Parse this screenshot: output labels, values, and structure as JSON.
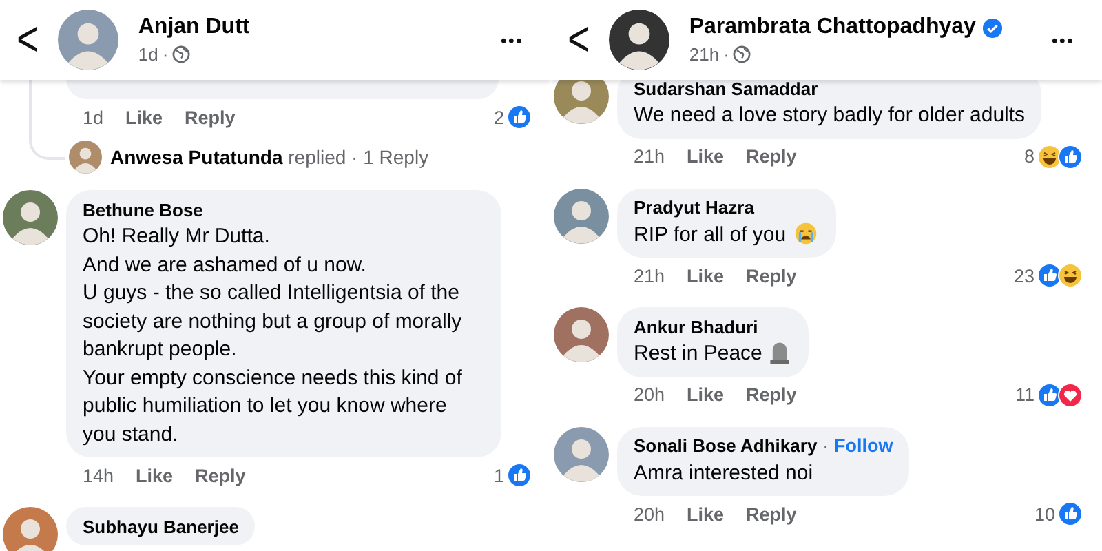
{
  "panels": [
    {
      "header": {
        "back": "<",
        "name": "Anjan Dutt",
        "verified": false,
        "time": "1d",
        "separator": "·",
        "more": "•••"
      },
      "comments": [
        {
          "kind": "hidden",
          "time": "1d",
          "like": "Like",
          "reply": "Reply",
          "count": "2",
          "reactions": [
            {
              "kind": "like"
            }
          ],
          "replies": "**Anwesa Putatunda** replied · 1 Reply"
        },
        {
          "kind": "comment",
          "name": "Bethune Bose",
          "text": "Oh! Really Mr Dutta.\nAnd we are ashamed of u now.\nU guys - the so called Intelligentsia of the society are nothing but a group of morally bankrupt people.\nYour empty conscience needs this kind of public humiliation to let you know where you stand.",
          "time": "14h",
          "like": "Like",
          "reply": "Reply",
          "count": "1",
          "reactions": [
            {
              "kind": "like"
            }
          ]
        },
        {
          "kind": "comment",
          "name": "Subhayu Banerjee"
        }
      ]
    },
    {
      "header": {
        "back": "<",
        "name": "Parambrata Chattopadhyay",
        "verified": true,
        "time": "21h",
        "separator": "·",
        "more": "•••"
      },
      "comments": [
        {
          "kind": "comment",
          "name": "Sudarshan Samaddar",
          "text": "We need a love story badly for older adults",
          "time": "21h",
          "like": "Like",
          "reply": "Reply",
          "count": "8",
          "reactions": [
            {
              "kind": "haha"
            },
            {
              "kind": "like"
            }
          ]
        },
        {
          "kind": "comment",
          "name": "Pradyut Hazra",
          "text": "RIP for all of you",
          "trailing_icon": {
            "kind": "crying"
          },
          "time": "21h",
          "like": "Like",
          "reply": "Reply",
          "count": "23",
          "reactions": [
            {
              "kind": "like"
            },
            {
              "kind": "haha"
            }
          ]
        },
        {
          "kind": "comment",
          "name": "Ankur Bhaduri",
          "text": "Rest in Peace",
          "trailing_icon": {
            "kind": "tombstone"
          },
          "time": "20h",
          "like": "Like",
          "reply": "Reply",
          "count": "11",
          "reactions": [
            {
              "kind": "like"
            },
            {
              "kind": "love"
            }
          ]
        },
        {
          "kind": "comment",
          "name": "Sonali Bose Adhikary",
          "follow_separator": "·",
          "follow": "Follow",
          "text": "Amra interested noi",
          "time": "20h",
          "like": "Like",
          "reply": "Reply",
          "count": "10",
          "reactions": [
            {
              "kind": "like"
            }
          ]
        }
      ]
    }
  ]
}
